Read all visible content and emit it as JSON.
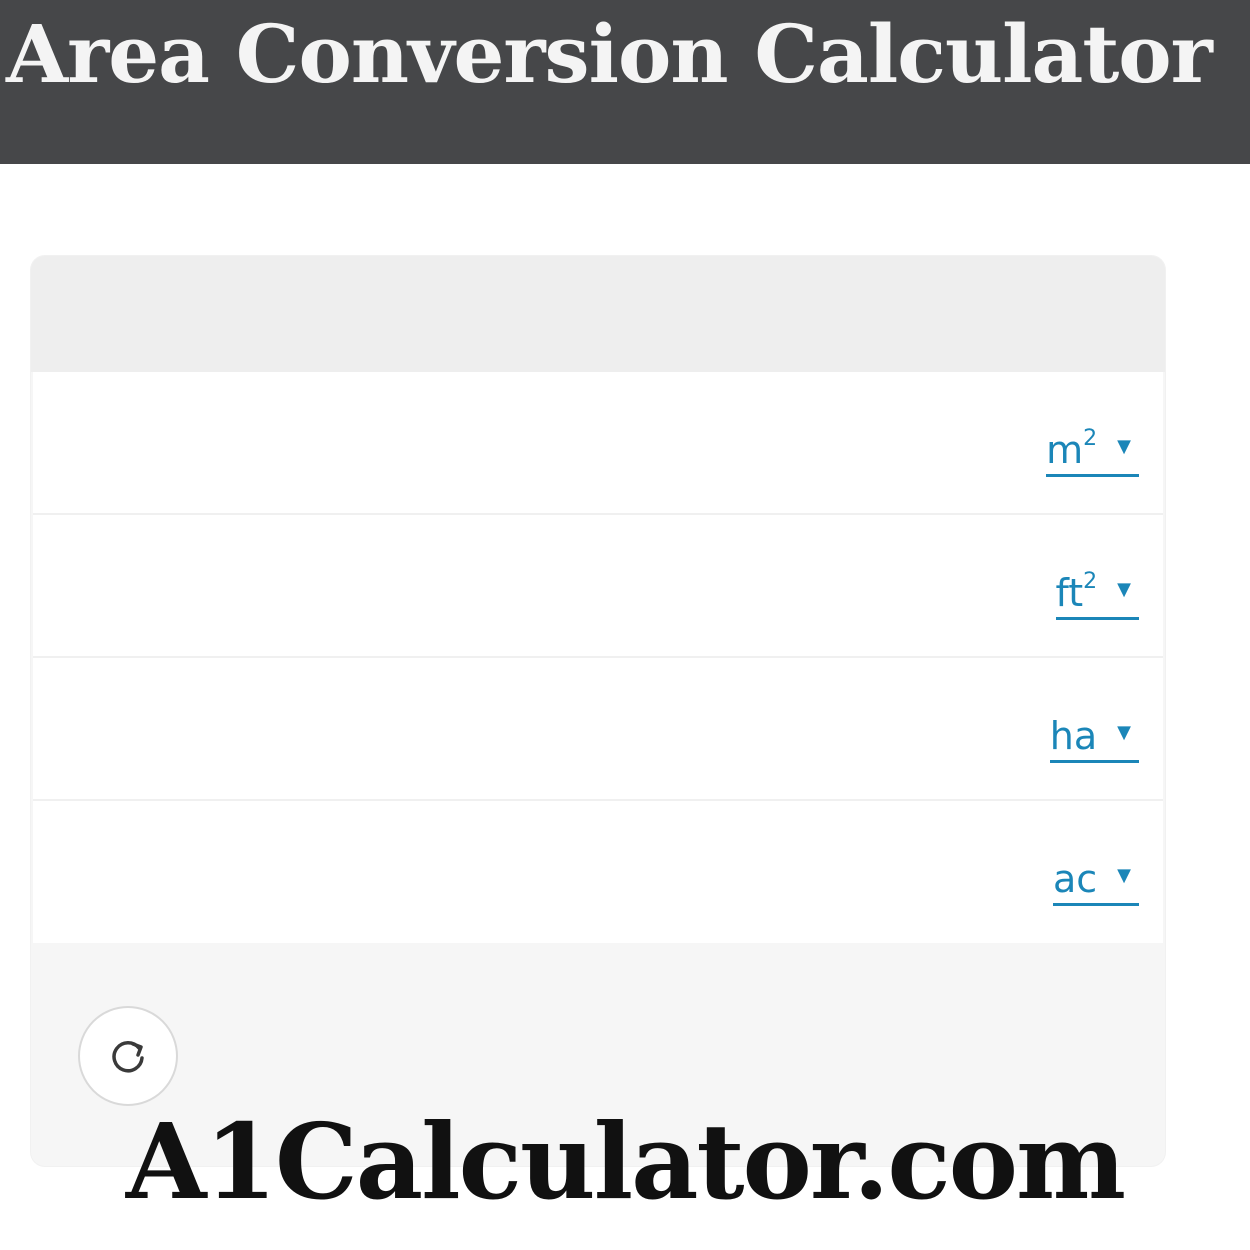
{
  "header": {
    "title": "Area Conversion Calculator"
  },
  "converter": {
    "rows": [
      {
        "value": "",
        "unit_base": "m",
        "unit_sup": "2"
      },
      {
        "value": "",
        "unit_base": "ft",
        "unit_sup": "2"
      },
      {
        "value": "",
        "unit_base": "ha",
        "unit_sup": ""
      },
      {
        "value": "",
        "unit_base": "ac",
        "unit_sup": ""
      }
    ],
    "caret_glyph": "▼",
    "reset_icon": "refresh-icon"
  },
  "watermark": {
    "text": "A1Calculator.com"
  },
  "colors": {
    "header_bg": "#464749",
    "link_blue": "#1b86b8",
    "card_bg": "#f6f6f6"
  }
}
